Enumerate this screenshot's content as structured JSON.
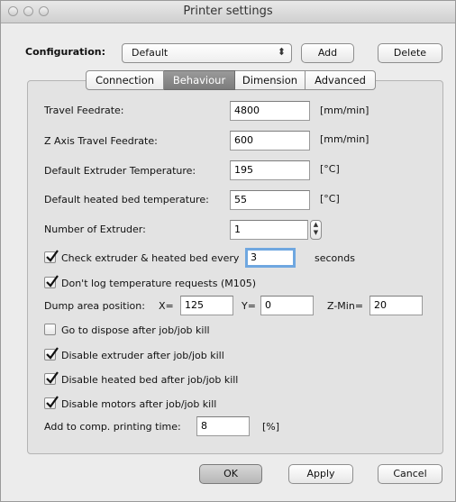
{
  "window": {
    "title": "Printer settings"
  },
  "config": {
    "label": "Configuration:",
    "value": "Default",
    "add": "Add",
    "delete": "Delete"
  },
  "tabs": [
    "Connection",
    "Behaviour",
    "Dimension",
    "Advanced"
  ],
  "fields": {
    "travel_feedrate": {
      "label": "Travel Feedrate:",
      "value": "4800",
      "unit": "[mm/min]"
    },
    "z_feedrate": {
      "label": "Z Axis Travel Feedrate:",
      "value": "600",
      "unit": "[mm/min]"
    },
    "extruder_temp": {
      "label": "Default Extruder Temperature:",
      "value": "195",
      "unit": "[°C]"
    },
    "bed_temp": {
      "label": "Default heated bed temperature:",
      "value": "55",
      "unit": "[°C]"
    },
    "num_extruder": {
      "label": "Number of Extruder:",
      "value": "1"
    }
  },
  "check_temp": {
    "label": "Check extruder & heated bed every",
    "value": "3",
    "unit": "seconds",
    "checked": true
  },
  "no_log": {
    "label": "Don't log temperature requests (M105)",
    "checked": true
  },
  "dump": {
    "label": "Dump area position:",
    "x_label": "X=",
    "x": "125",
    "y_label": "Y=",
    "y": "0",
    "z_label": "Z-Min=",
    "z": "20"
  },
  "options": {
    "dispose": {
      "label": "Go to dispose after job/job kill",
      "checked": false
    },
    "disable_extruder": {
      "label": "Disable extruder after job/job kill",
      "checked": true
    },
    "disable_bed": {
      "label": "Disable heated bed after job/job kill",
      "checked": true
    },
    "disable_motors": {
      "label": "Disable motors after job/job kill",
      "checked": true
    }
  },
  "comp_time": {
    "label": "Add to comp. printing time:",
    "value": "8",
    "unit": "[%]"
  },
  "buttons": {
    "ok": "OK",
    "apply": "Apply",
    "cancel": "Cancel"
  }
}
